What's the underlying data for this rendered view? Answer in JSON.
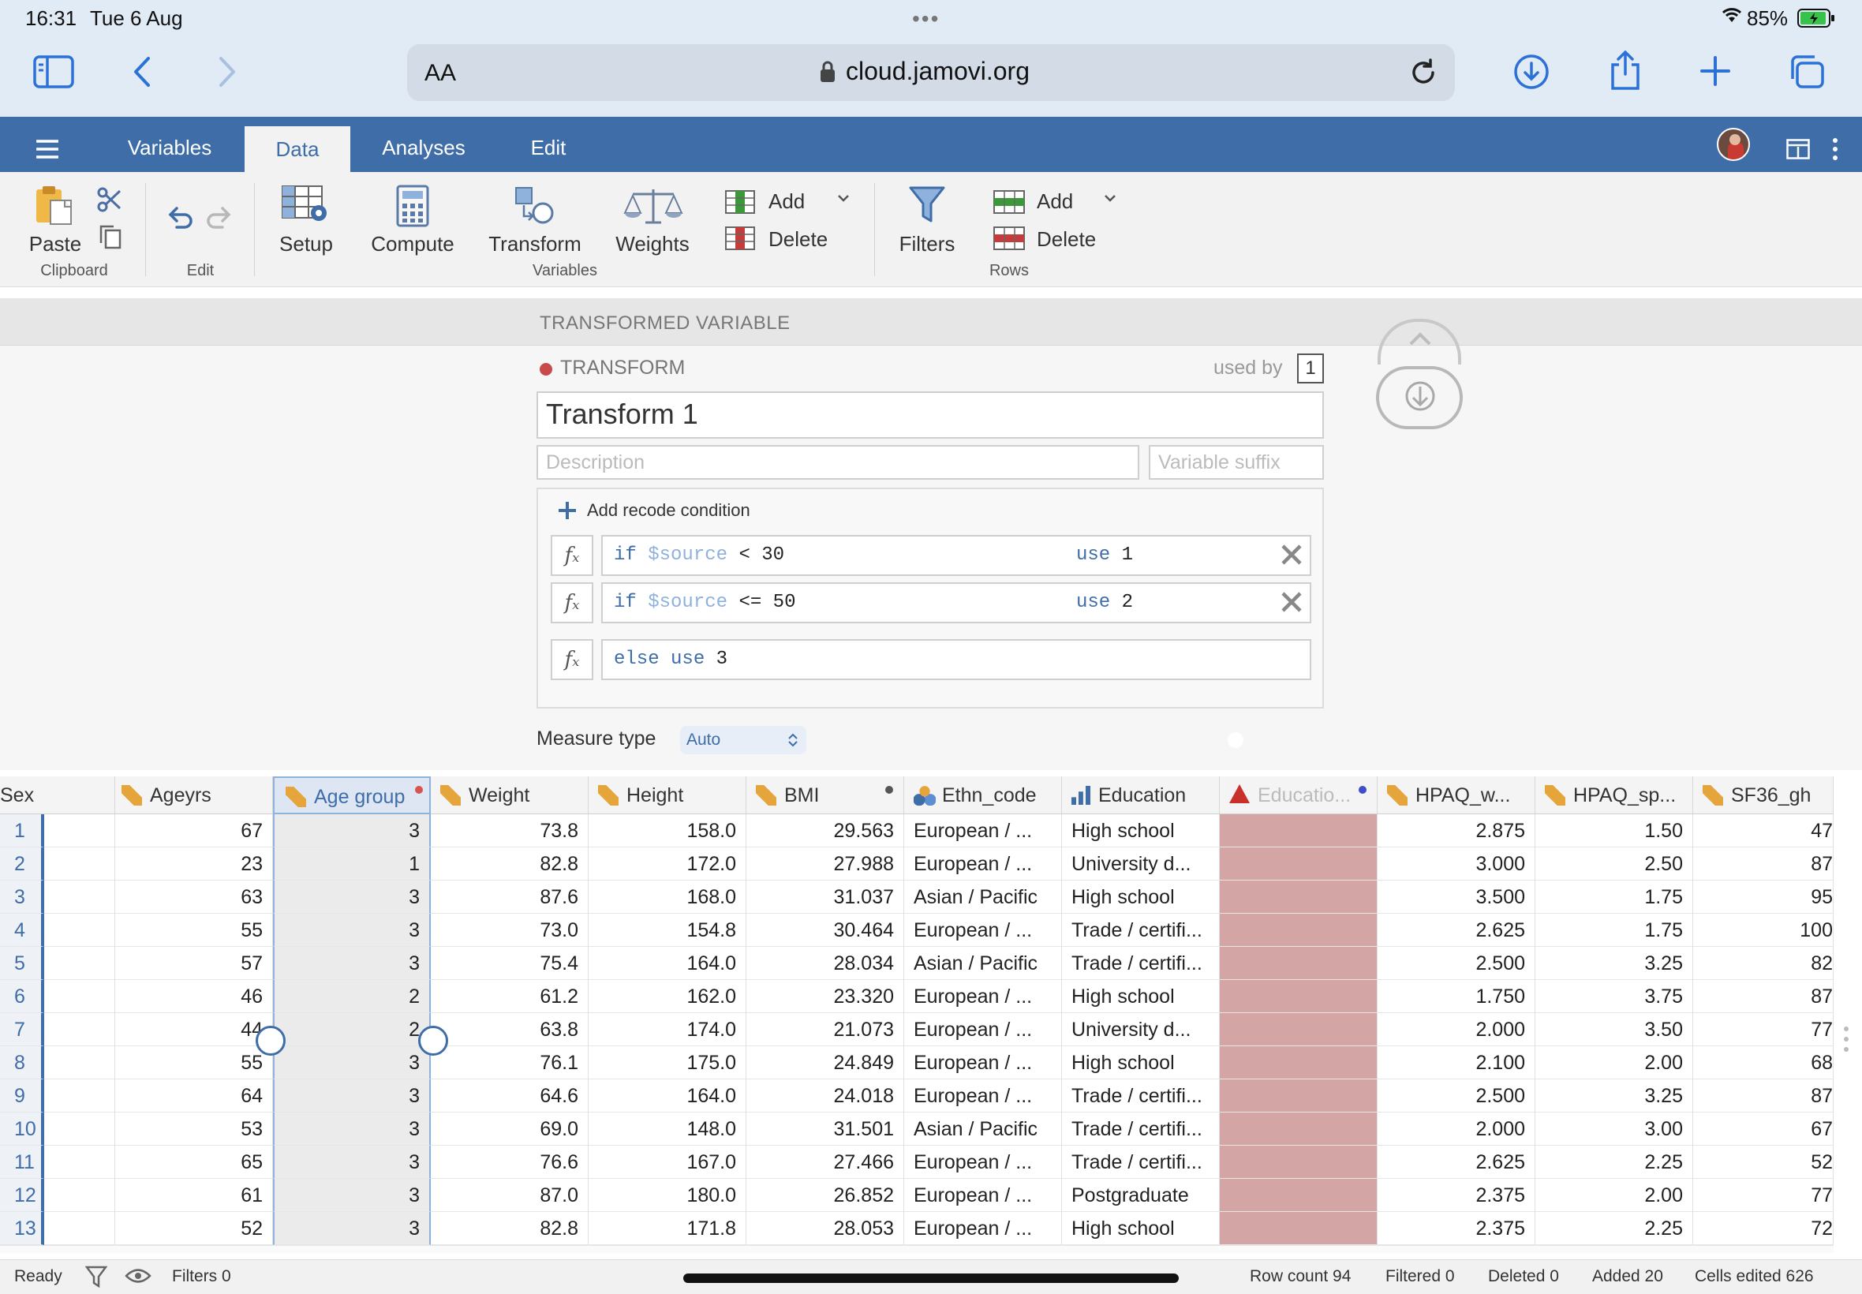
{
  "status_bar": {
    "time": "16:31",
    "date": "Tue 6 Aug",
    "battery": "85%"
  },
  "safari": {
    "text_size": "AA",
    "url": "cloud.jamovi.org"
  },
  "jamovi": {
    "tabs": [
      "Variables",
      "Data",
      "Analyses",
      "Edit"
    ],
    "active_tab": "Data",
    "toolbar": {
      "paste": "Paste",
      "clipboard": "Clipboard",
      "edit": "Edit",
      "setup": "Setup",
      "compute": "Compute",
      "transform": "Transform",
      "weights": "Weights",
      "variables": "Variables",
      "add": "Add",
      "delete": "Delete",
      "filters": "Filters",
      "rows": "Rows",
      "add_rows": "Add",
      "delete_rows": "Delete"
    },
    "panel": {
      "header": "TRANSFORMED VARIABLE",
      "section": "TRANSFORM",
      "used_by_label": "used by",
      "used_by_count": "1",
      "name": "Transform 1",
      "description_placeholder": "Description",
      "suffix_placeholder": "Variable suffix",
      "add_condition": "Add recode condition",
      "conditions": [
        {
          "if": "if",
          "var": "$source",
          "op": "< 30",
          "use": "use",
          "val": "1"
        },
        {
          "if": "if",
          "var": "$source",
          "op": "<= 50",
          "use": "use",
          "val": "2"
        }
      ],
      "else_kw": "else use",
      "else_val": "3",
      "measure_label": "Measure type",
      "measure_value": "Auto"
    }
  },
  "grid": {
    "columns": [
      "Sex",
      "Ageyrs",
      "Age group",
      "Weight",
      "Height",
      "BMI",
      "Ethn_code",
      "Education",
      "Educatio...",
      "HPAQ_w...",
      "HPAQ_sp...",
      "SF36_gh"
    ],
    "rows": [
      [
        "1",
        "",
        "67",
        "3",
        "73.8",
        "158.0",
        "29.563",
        "European / ...",
        "High school",
        "",
        "2.875",
        "1.50",
        "47"
      ],
      [
        "2",
        "",
        "23",
        "1",
        "82.8",
        "172.0",
        "27.988",
        "European / ...",
        "University d...",
        "",
        "3.000",
        "2.50",
        "87"
      ],
      [
        "3",
        "",
        "63",
        "3",
        "87.6",
        "168.0",
        "31.037",
        "Asian / Pacific",
        "High school",
        "",
        "3.500",
        "1.75",
        "95"
      ],
      [
        "4",
        "",
        "55",
        "3",
        "73.0",
        "154.8",
        "30.464",
        "European / ...",
        "Trade / certifi...",
        "",
        "2.625",
        "1.75",
        "100"
      ],
      [
        "5",
        "",
        "57",
        "3",
        "75.4",
        "164.0",
        "28.034",
        "Asian / Pacific",
        "Trade / certifi...",
        "",
        "2.500",
        "3.25",
        "82"
      ],
      [
        "6",
        "",
        "46",
        "2",
        "61.2",
        "162.0",
        "23.320",
        "European / ...",
        "High school",
        "",
        "1.750",
        "3.75",
        "87"
      ],
      [
        "7",
        "",
        "44",
        "2",
        "63.8",
        "174.0",
        "21.073",
        "European / ...",
        "University d...",
        "",
        "2.000",
        "3.50",
        "77"
      ],
      [
        "8",
        "",
        "55",
        "3",
        "76.1",
        "175.0",
        "24.849",
        "European / ...",
        "High school",
        "",
        "2.100",
        "2.00",
        "68"
      ],
      [
        "9",
        "",
        "64",
        "3",
        "64.6",
        "164.0",
        "24.018",
        "European / ...",
        "Trade / certifi...",
        "",
        "2.500",
        "3.25",
        "87"
      ],
      [
        "10",
        "",
        "53",
        "3",
        "69.0",
        "148.0",
        "31.501",
        "Asian / Pacific",
        "Trade / certifi...",
        "",
        "2.000",
        "3.00",
        "67"
      ],
      [
        "11",
        "",
        "65",
        "3",
        "76.6",
        "167.0",
        "27.466",
        "European / ...",
        "Trade / certifi...",
        "",
        "2.625",
        "2.25",
        "52"
      ],
      [
        "12",
        "",
        "61",
        "3",
        "87.0",
        "180.0",
        "26.852",
        "European / ...",
        "Postgraduate",
        "",
        "2.375",
        "2.00",
        "77"
      ],
      [
        "13",
        "",
        "52",
        "3",
        "82.8",
        "171.8",
        "28.053",
        "European / ...",
        "High school",
        "",
        "2.375",
        "2.25",
        "72"
      ]
    ]
  },
  "footer": {
    "ready": "Ready",
    "filters": "Filters 0",
    "row_count": "Row count 94",
    "filtered": "Filtered 0",
    "deleted": "Deleted 0",
    "added": "Added 20",
    "cells_edited": "Cells edited 626"
  },
  "colors": {
    "header_blue": "#3e6da8",
    "error_cell": "#d4a5a5",
    "ruler_orange": "#e6a53a"
  }
}
